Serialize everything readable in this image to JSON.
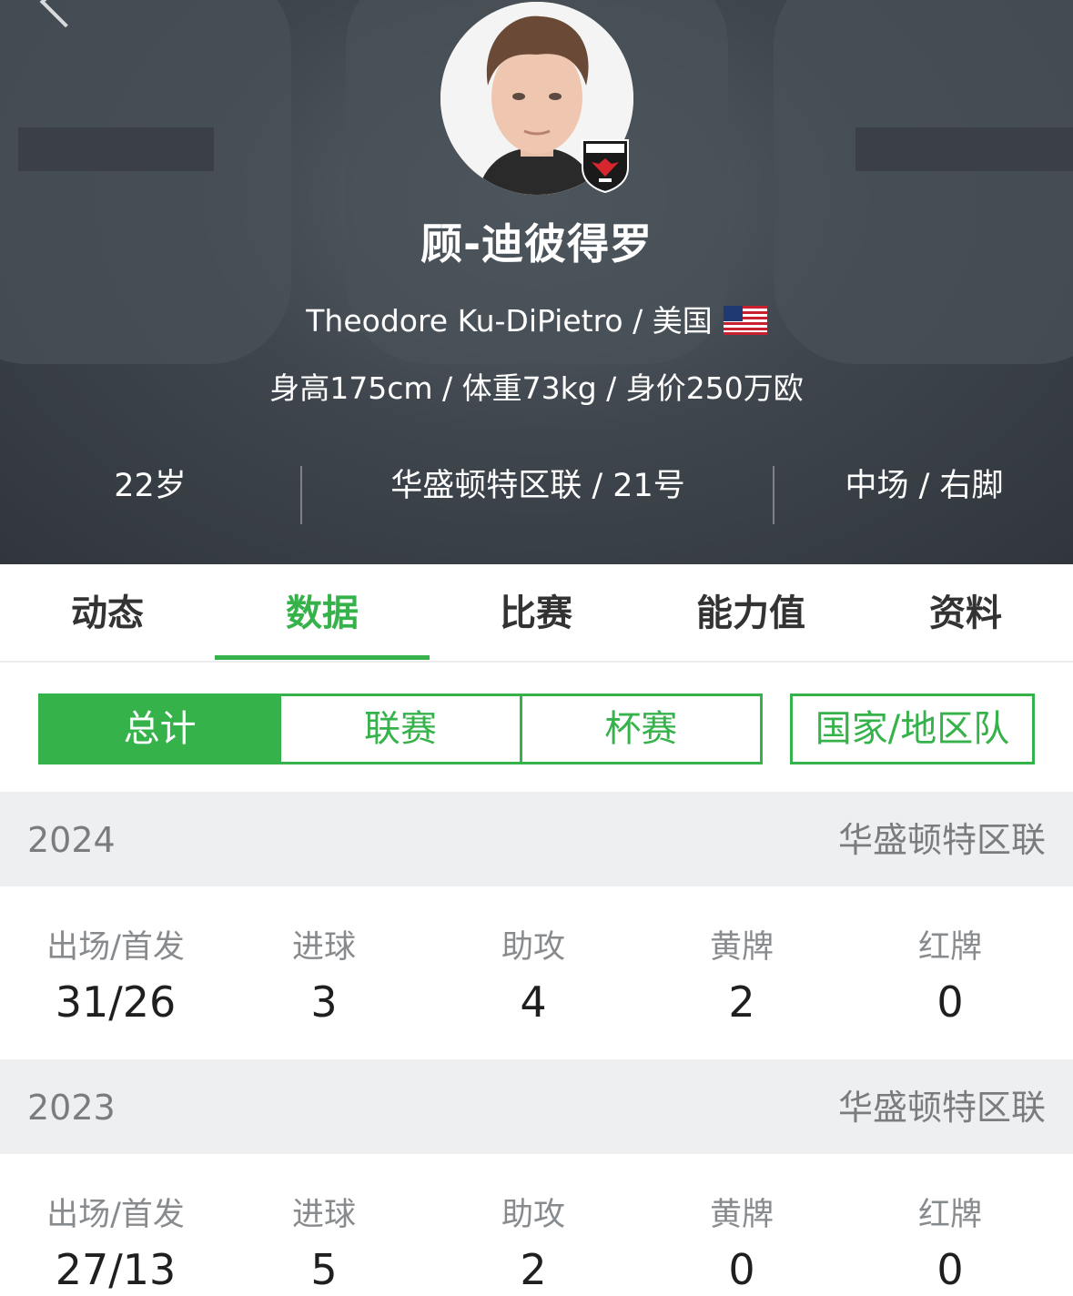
{
  "player": {
    "name_cn": "顾-迪彼得罗",
    "name_en_country": "Theodore Ku-DiPietro / 美国",
    "physical": "身高175cm / 体重73kg / 身价250万欧",
    "age": "22岁",
    "club_number": "华盛顿特区联 / 21号",
    "position_foot": "中场 / 右脚"
  },
  "icons": {
    "back": "chevron-left-icon",
    "flag": "us-flag-icon",
    "club_badge": "dc-united-badge-icon"
  },
  "tabs": [
    {
      "label": "动态"
    },
    {
      "label": "数据"
    },
    {
      "label": "比赛"
    },
    {
      "label": "能力值"
    },
    {
      "label": "资料"
    }
  ],
  "active_tab": "数据",
  "segment": [
    {
      "label": "总计"
    },
    {
      "label": "联赛"
    },
    {
      "label": "杯赛"
    }
  ],
  "national_team_label": "国家/地区队",
  "stat_labels": {
    "apps": "出场/首发",
    "goals": "进球",
    "assists": "助攻",
    "yellow": "黄牌",
    "red": "红牌"
  },
  "seasons": [
    {
      "year": "2024",
      "club": "华盛顿特区联",
      "apps": "31/26",
      "goals": "3",
      "assists": "4",
      "yellow": "2",
      "red": "0"
    },
    {
      "year": "2023",
      "club": "华盛顿特区联",
      "apps": "27/13",
      "goals": "5",
      "assists": "2",
      "yellow": "0",
      "red": "0"
    }
  ],
  "colors": {
    "accent": "#36b24a",
    "header_bg": "#3f464d",
    "season_bg": "#edeff0"
  }
}
